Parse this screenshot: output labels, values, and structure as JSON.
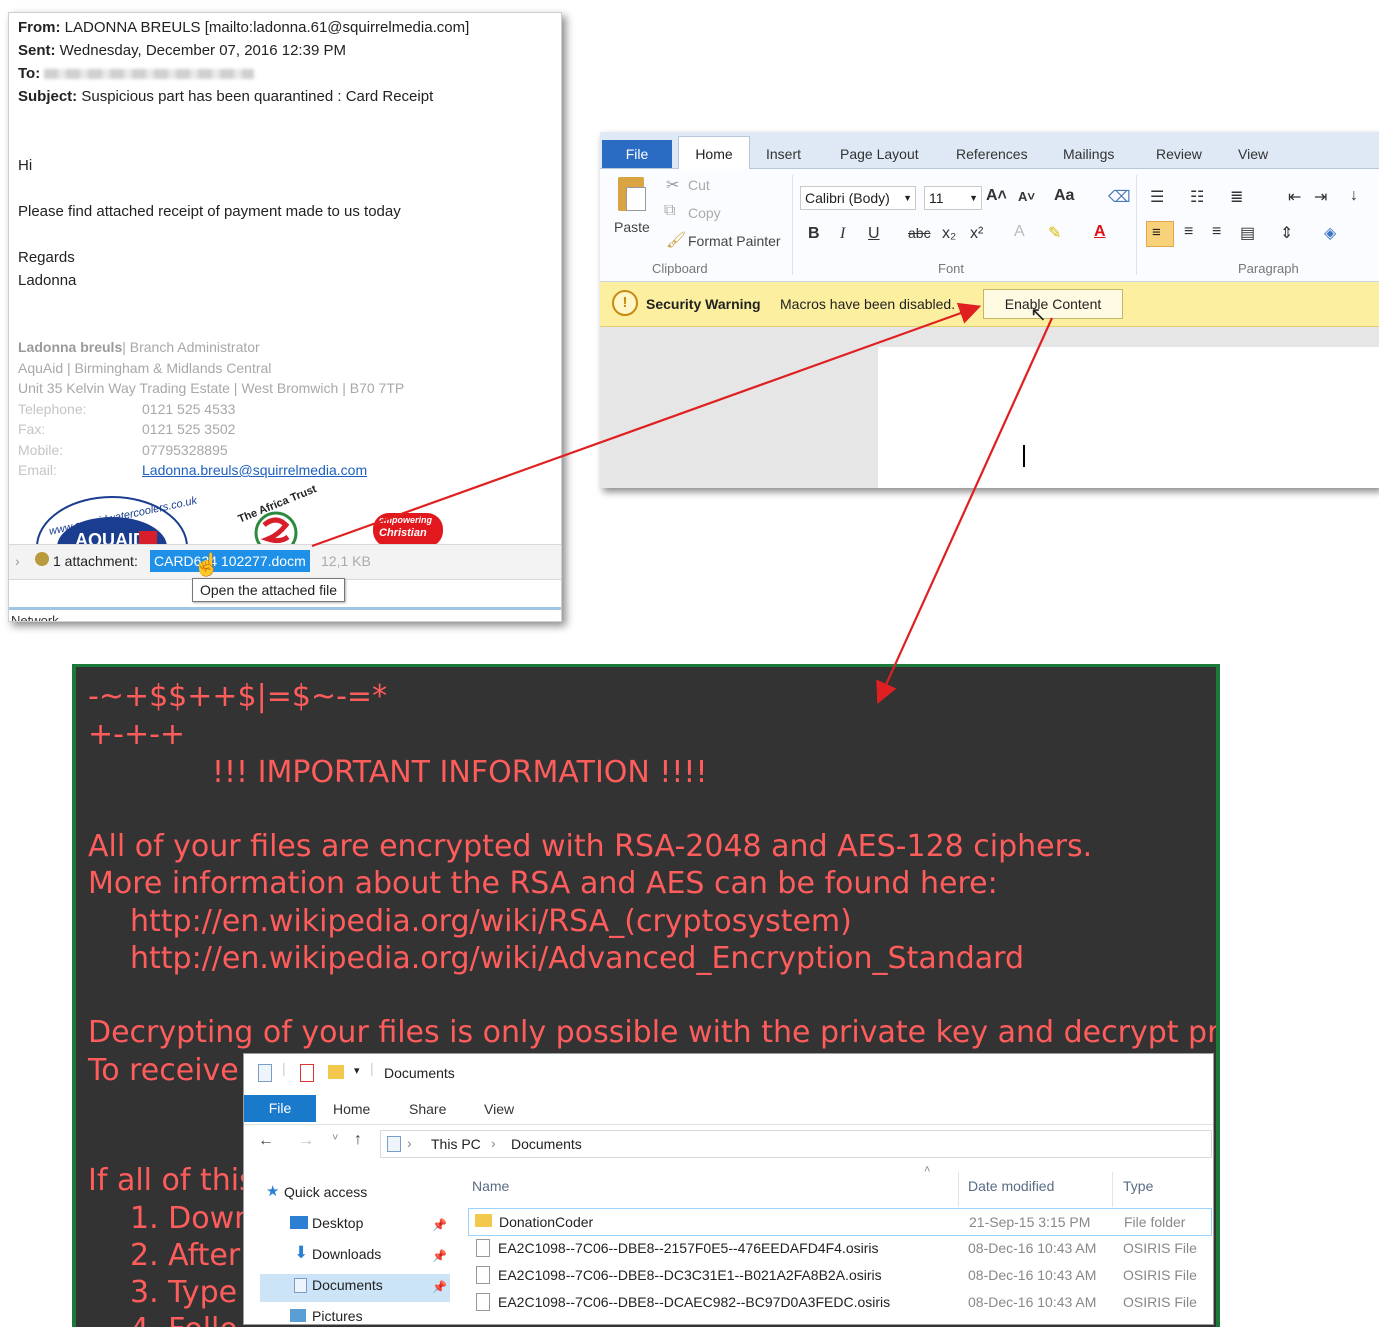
{
  "email": {
    "from_label": "From:",
    "from_value": "LADONNA BREULS [mailto:ladonna.61@squirrelmedia.com]",
    "sent_label": "Sent:",
    "sent_value": "Wednesday, December 07, 2016 12:39 PM",
    "to_label": "To:",
    "subject_label": "Subject:",
    "subject_value": "Suspicious part has been quarantined : Card Receipt",
    "greeting": "Hi",
    "body": "Please find attached receipt of payment made to us today",
    "regards": "Regards",
    "sender_first": "Ladonna",
    "signature": {
      "name": "Ladonna breuls",
      "title": "| Branch Administrator",
      "org": "AquAid | Birmingham & Midlands Central",
      "address": "Unit 35 Kelvin Way Trading Estate | West Bromwich | B70 7TP",
      "telephone_label": "Telephone:",
      "telephone": "0121 525 4533",
      "fax_label": "Fax:",
      "fax": "0121 525 3502",
      "mobile_label": "Mobile:",
      "mobile": "07795328895",
      "email_label": "Email:",
      "email": "Ladonna.breuls@squirrelmedia.com"
    },
    "logos": {
      "aquaid_ring": "www.aquaidwatercoolers.co.uk",
      "aquaid": "AQUAID",
      "africa_trust": "The Africa Trust",
      "christian_aid_top": "empowering",
      "christian_aid": "Christian"
    },
    "attachment_label": "1 attachment:",
    "attachment_file": "CARD634 102277.docm",
    "attachment_size": "12,1 KB",
    "tooltip": "Open the attached file",
    "network": "Network"
  },
  "word": {
    "tabs": [
      "File",
      "Home",
      "Insert",
      "Page Layout",
      "References",
      "Mailings",
      "Review",
      "View"
    ],
    "clipboard": {
      "paste": "Paste",
      "cut": "Cut",
      "copy": "Copy",
      "format_painter": "Format Painter",
      "group": "Clipboard"
    },
    "font": {
      "name": "Calibri (Body)",
      "size": "11",
      "group": "Font"
    },
    "paragraph_group": "Paragraph",
    "security_title": "Security Warning",
    "security_message": "Macros have been disabled.",
    "enable_button": "Enable Content"
  },
  "ransom": {
    "line1": "-~+$$++$|=$~-=*",
    "line2": "+-+-+",
    "line3": "!!! IMPORTANT INFORMATION !!!!",
    "line4": "All of your files are encrypted with RSA-2048 and AES-128 ciphers.",
    "line5": "More information about the RSA and AES can be found here:",
    "line6": "http://en.wikipedia.org/wiki/RSA_(cryptosystem)",
    "line7": "http://en.wikipedia.org/wiki/Advanced_Encryption_Standard",
    "line8": "Decrypting of your files is only possible with the private key and decrypt program,",
    "line9": "To receive",
    "line10": "If all of this",
    "line11": "1. Down",
    "line12": "2. After",
    "line13": "3. Type",
    "line14": "4. Follo",
    "text_color": "#ff5c5c",
    "bg_color": "#333333"
  },
  "explorer": {
    "title": "Documents",
    "tabs": [
      "File",
      "Home",
      "Share",
      "View"
    ],
    "breadcrumb": [
      "This PC",
      "Documents"
    ],
    "nav": [
      {
        "label": "Quick access",
        "icon": "star-icon"
      },
      {
        "label": "Desktop",
        "icon": "desktop-icon"
      },
      {
        "label": "Downloads",
        "icon": "download-icon"
      },
      {
        "label": "Documents",
        "icon": "documents-icon"
      },
      {
        "label": "Pictures",
        "icon": "pictures-icon"
      }
    ],
    "columns": {
      "name": "Name",
      "date": "Date modified",
      "type": "Type"
    },
    "rows": [
      {
        "name": "DonationCoder",
        "date": "21-Sep-15 3:15 PM",
        "type": "File folder"
      },
      {
        "name": "EA2C1098--7C06--DBE8--2157F0E5--476EEDAFD4F4.osiris",
        "date": "08-Dec-16 10:43 AM",
        "type": "OSIRIS File"
      },
      {
        "name": "EA2C1098--7C06--DBE8--DC3C31E1--B021A2FA8B2A.osiris",
        "date": "08-Dec-16 10:43 AM",
        "type": "OSIRIS File"
      },
      {
        "name": "EA2C1098--7C06--DBE8--DCAEC982--BC97D0A3FEDC.osiris",
        "date": "08-Dec-16 10:43 AM",
        "type": "OSIRIS File"
      }
    ]
  },
  "colors": {
    "arrow": "#e02020",
    "word_accent": "#2a6bc4",
    "explorer_accent": "#1979ca",
    "selection": "#1e90e8"
  }
}
